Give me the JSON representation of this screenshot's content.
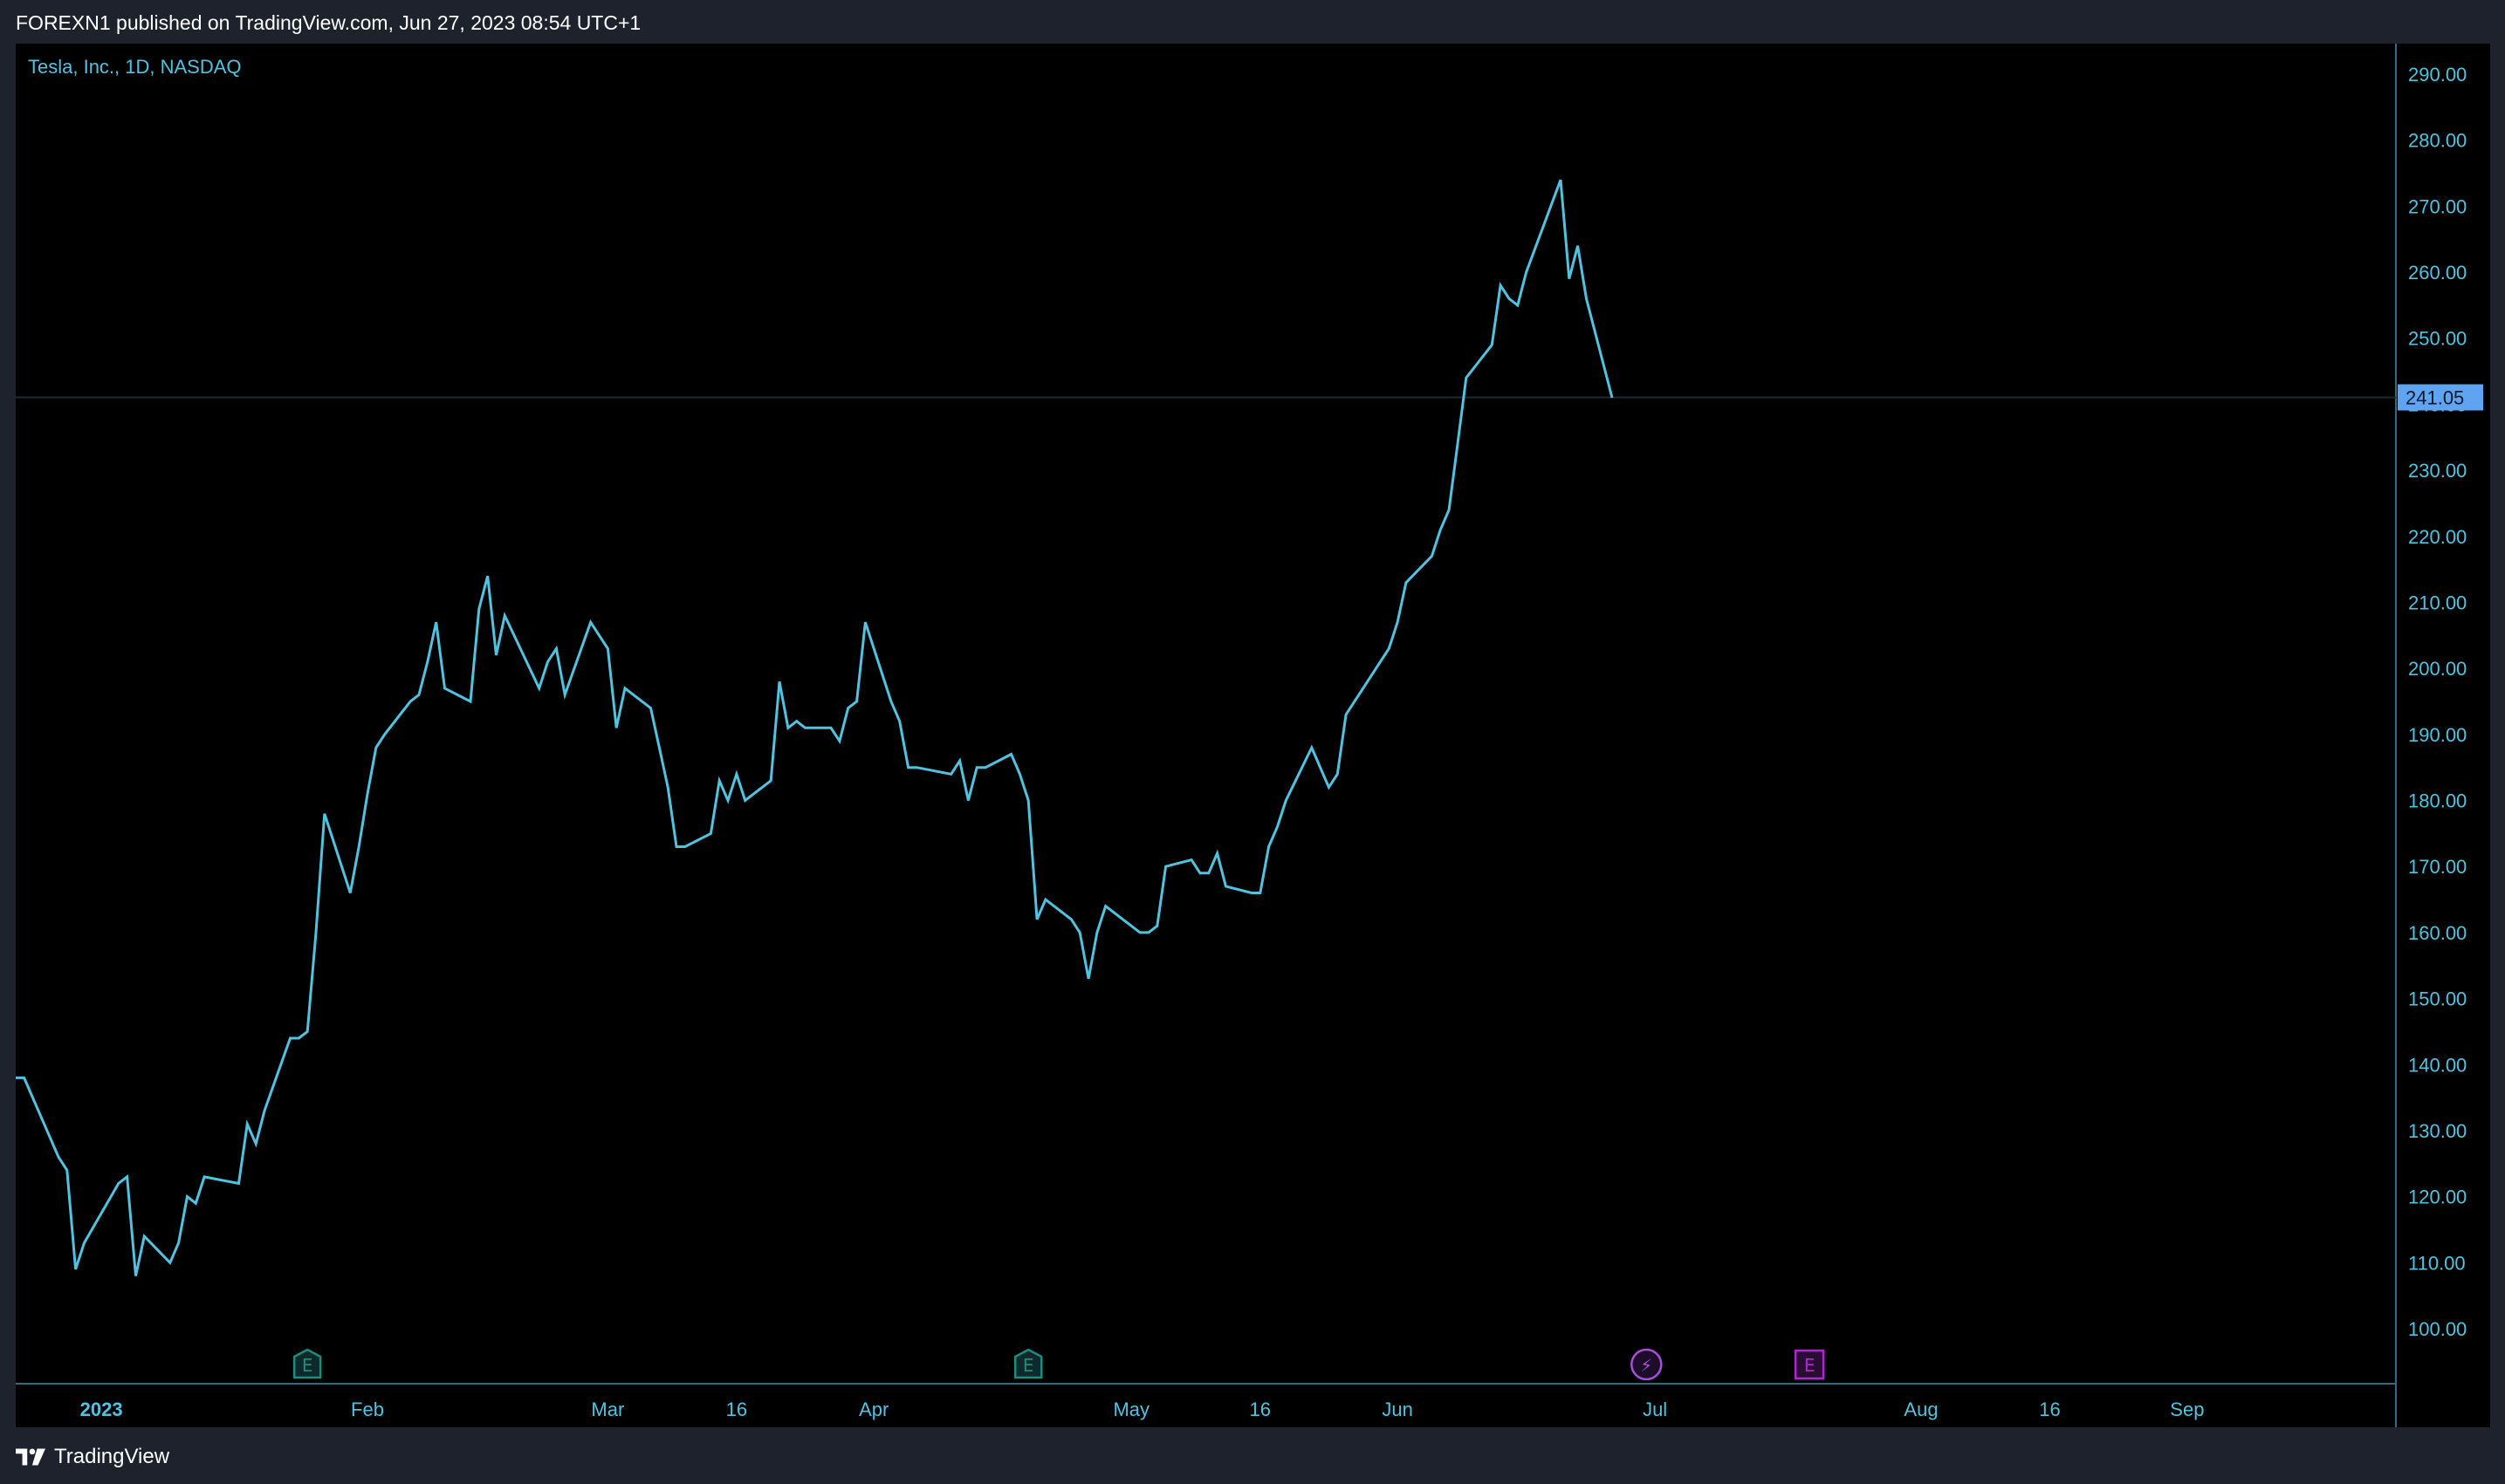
{
  "header": {
    "text": "FOREXN1 published on TradingView.com, Jun 27, 2023 08:54 UTC+1"
  },
  "footer": {
    "brand": "TradingView"
  },
  "colors": {
    "background": "#000000",
    "frame": "#1e222d",
    "line": "#4fc3e0",
    "last_price_badge": "#5ea4f2"
  },
  "chart_data": {
    "type": "line",
    "title": "Tesla, Inc., 1D, NASDAQ",
    "xlabel": "",
    "ylabel": "",
    "ylim": [
      90,
      295
    ],
    "y_ticks": [
      100,
      110,
      120,
      130,
      140,
      150,
      160,
      170,
      180,
      190,
      200,
      210,
      220,
      230,
      240,
      250,
      260,
      270,
      280,
      290
    ],
    "y_tick_labels": [
      "100.00",
      "110.00",
      "120.00",
      "130.00",
      "140.00",
      "150.00",
      "160.00",
      "170.00",
      "180.00",
      "190.00",
      "200.00",
      "210.00",
      "220.00",
      "230.00",
      "240.00",
      "250.00",
      "260.00",
      "270.00",
      "280.00",
      "290.00"
    ],
    "x_ticks": [
      {
        "date": "2023-01-01",
        "label": "2023",
        "bold": true
      },
      {
        "date": "2023-02-01",
        "label": "Feb",
        "bold": false
      },
      {
        "date": "2023-03-01",
        "label": "Mar",
        "bold": false
      },
      {
        "date": "2023-03-16",
        "label": "16",
        "bold": false
      },
      {
        "date": "2023-04-01",
        "label": "Apr",
        "bold": false
      },
      {
        "date": "2023-05-01",
        "label": "May",
        "bold": false
      },
      {
        "date": "2023-05-16",
        "label": "16",
        "bold": false
      },
      {
        "date": "2023-06-01",
        "label": "Jun",
        "bold": false
      },
      {
        "date": "2023-07-01",
        "label": "Jul",
        "bold": false
      },
      {
        "date": "2023-08-01",
        "label": "Aug",
        "bold": false
      },
      {
        "date": "2023-08-16",
        "label": "16",
        "bold": false
      },
      {
        "date": "2023-09-01",
        "label": "Sep",
        "bold": false
      }
    ],
    "last_price": 241.05,
    "last_price_label": "241.05",
    "events": [
      {
        "date": "2023-01-25",
        "type": "earnings",
        "label": "E",
        "color": "#1f8a80"
      },
      {
        "date": "2023-04-19",
        "type": "earnings",
        "label": "E",
        "color": "#1f8a80"
      },
      {
        "date": "2023-06-30",
        "type": "dividend-split",
        "label": "⚡",
        "color": "#a74fd8"
      },
      {
        "date": "2023-07-19",
        "type": "earnings",
        "label": "E",
        "color": "#b026d0"
      }
    ],
    "series": [
      {
        "points": [
          [
            "2022-12-22",
            138
          ],
          [
            "2022-12-23",
            138
          ],
          [
            "2022-12-27",
            126
          ],
          [
            "2022-12-28",
            124
          ],
          [
            "2022-12-29",
            109
          ],
          [
            "2022-12-30",
            113
          ],
          [
            "2023-01-03",
            122
          ],
          [
            "2023-01-04",
            123
          ],
          [
            "2023-01-05",
            108
          ],
          [
            "2023-01-06",
            114
          ],
          [
            "2023-01-09",
            110
          ],
          [
            "2023-01-10",
            113
          ],
          [
            "2023-01-11",
            120
          ],
          [
            "2023-01-12",
            119
          ],
          [
            "2023-01-13",
            123
          ],
          [
            "2023-01-17",
            122
          ],
          [
            "2023-01-18",
            131
          ],
          [
            "2023-01-19",
            128
          ],
          [
            "2023-01-20",
            133
          ],
          [
            "2023-01-23",
            144
          ],
          [
            "2023-01-24",
            144
          ],
          [
            "2023-01-25",
            145
          ],
          [
            "2023-01-26",
            160
          ],
          [
            "2023-01-27",
            178
          ],
          [
            "2023-01-30",
            166
          ],
          [
            "2023-01-31",
            173
          ],
          [
            "2023-02-01",
            181
          ],
          [
            "2023-02-02",
            188
          ],
          [
            "2023-02-03",
            190
          ],
          [
            "2023-02-06",
            195
          ],
          [
            "2023-02-07",
            196
          ],
          [
            "2023-02-08",
            201
          ],
          [
            "2023-02-09",
            207
          ],
          [
            "2023-02-10",
            197
          ],
          [
            "2023-02-13",
            195
          ],
          [
            "2023-02-14",
            209
          ],
          [
            "2023-02-15",
            214
          ],
          [
            "2023-02-16",
            202
          ],
          [
            "2023-02-17",
            208
          ],
          [
            "2023-02-21",
            197
          ],
          [
            "2023-02-22",
            201
          ],
          [
            "2023-02-23",
            203
          ],
          [
            "2023-02-24",
            196
          ],
          [
            "2023-02-27",
            207
          ],
          [
            "2023-02-28",
            205
          ],
          [
            "2023-03-01",
            203
          ],
          [
            "2023-03-02",
            191
          ],
          [
            "2023-03-03",
            197
          ],
          [
            "2023-03-06",
            194
          ],
          [
            "2023-03-07",
            188
          ],
          [
            "2023-03-08",
            182
          ],
          [
            "2023-03-09",
            173
          ],
          [
            "2023-03-10",
            173
          ],
          [
            "2023-03-13",
            175
          ],
          [
            "2023-03-14",
            183
          ],
          [
            "2023-03-15",
            180
          ],
          [
            "2023-03-16",
            184
          ],
          [
            "2023-03-17",
            180
          ],
          [
            "2023-03-20",
            183
          ],
          [
            "2023-03-21",
            198
          ],
          [
            "2023-03-22",
            191
          ],
          [
            "2023-03-23",
            192
          ],
          [
            "2023-03-24",
            191
          ],
          [
            "2023-03-27",
            191
          ],
          [
            "2023-03-28",
            189
          ],
          [
            "2023-03-29",
            194
          ],
          [
            "2023-03-30",
            195
          ],
          [
            "2023-03-31",
            207
          ],
          [
            "2023-04-03",
            195
          ],
          [
            "2023-04-04",
            192
          ],
          [
            "2023-04-05",
            185
          ],
          [
            "2023-04-06",
            185
          ],
          [
            "2023-04-10",
            184
          ],
          [
            "2023-04-11",
            186
          ],
          [
            "2023-04-12",
            180
          ],
          [
            "2023-04-13",
            185
          ],
          [
            "2023-04-14",
            185
          ],
          [
            "2023-04-17",
            187
          ],
          [
            "2023-04-18",
            184
          ],
          [
            "2023-04-19",
            180
          ],
          [
            "2023-04-20",
            162
          ],
          [
            "2023-04-21",
            165
          ],
          [
            "2023-04-24",
            162
          ],
          [
            "2023-04-25",
            160
          ],
          [
            "2023-04-26",
            153
          ],
          [
            "2023-04-27",
            160
          ],
          [
            "2023-04-28",
            164
          ],
          [
            "2023-05-01",
            161
          ],
          [
            "2023-05-02",
            160
          ],
          [
            "2023-05-03",
            160
          ],
          [
            "2023-05-04",
            161
          ],
          [
            "2023-05-05",
            170
          ],
          [
            "2023-05-08",
            171
          ],
          [
            "2023-05-09",
            169
          ],
          [
            "2023-05-10",
            169
          ],
          [
            "2023-05-11",
            172
          ],
          [
            "2023-05-12",
            167
          ],
          [
            "2023-05-15",
            166
          ],
          [
            "2023-05-16",
            166
          ],
          [
            "2023-05-17",
            173
          ],
          [
            "2023-05-18",
            176
          ],
          [
            "2023-05-19",
            180
          ],
          [
            "2023-05-22",
            188
          ],
          [
            "2023-05-23",
            185
          ],
          [
            "2023-05-24",
            182
          ],
          [
            "2023-05-25",
            184
          ],
          [
            "2023-05-26",
            193
          ],
          [
            "2023-05-30",
            201
          ],
          [
            "2023-05-31",
            203
          ],
          [
            "2023-06-01",
            207
          ],
          [
            "2023-06-02",
            213
          ],
          [
            "2023-06-05",
            217
          ],
          [
            "2023-06-06",
            221
          ],
          [
            "2023-06-07",
            224
          ],
          [
            "2023-06-08",
            234
          ],
          [
            "2023-06-09",
            244
          ],
          [
            "2023-06-12",
            249
          ],
          [
            "2023-06-13",
            258
          ],
          [
            "2023-06-14",
            256
          ],
          [
            "2023-06-15",
            255
          ],
          [
            "2023-06-16",
            260
          ],
          [
            "2023-06-20",
            274
          ],
          [
            "2023-06-21",
            259
          ],
          [
            "2023-06-22",
            264
          ],
          [
            "2023-06-23",
            256
          ],
          [
            "2023-06-26",
            241
          ]
        ]
      }
    ]
  }
}
